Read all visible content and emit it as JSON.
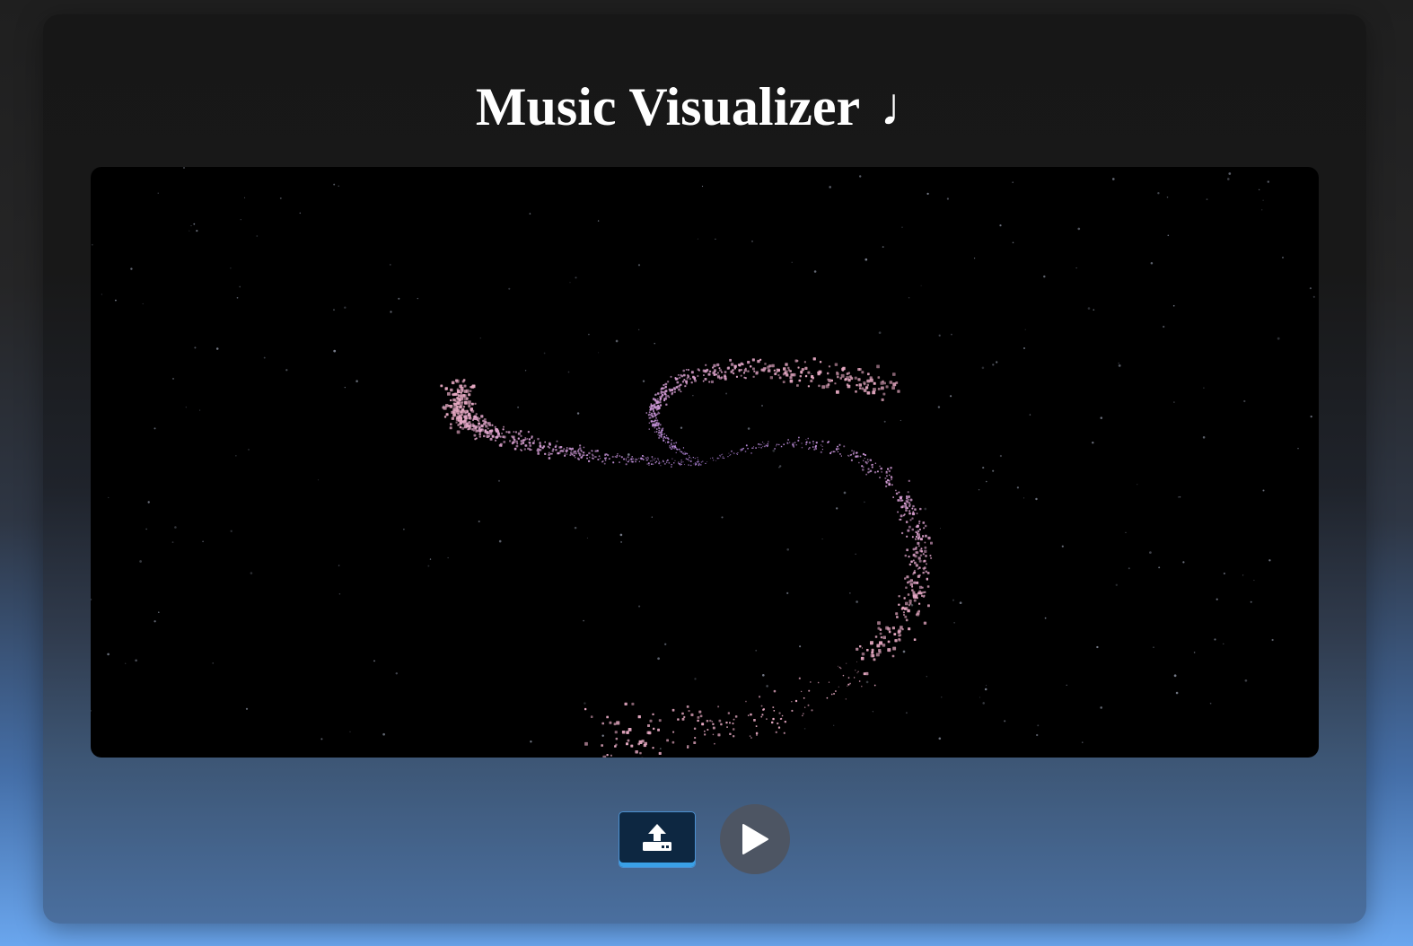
{
  "app": {
    "title": "Music Visualizer",
    "title_icon": "music-note-icon",
    "title_glyph": "♩"
  },
  "visualizer": {
    "style": "spiral-particles",
    "colors": {
      "background": "#000000",
      "particle_core": "#b98ae6",
      "particle_tail": "#e6a9c2",
      "stars": "#9fa6b8"
    }
  },
  "controls": {
    "upload_icon": "upload-icon",
    "play_icon": "play-icon",
    "upload_color": "#0d2741",
    "upload_accent": "#3aa0e6",
    "play_color": "#4d5563"
  }
}
